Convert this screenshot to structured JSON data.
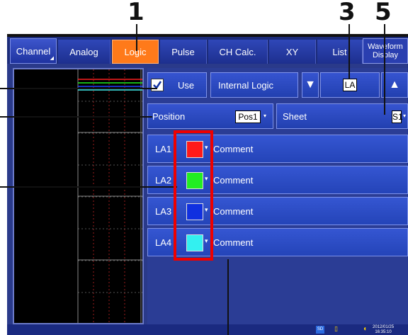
{
  "callouts": [
    "1",
    "3",
    "5"
  ],
  "tabs": [
    {
      "label": "Channel"
    },
    {
      "label": "Analog"
    },
    {
      "label": "Logic"
    },
    {
      "label": "Pulse"
    },
    {
      "label": "CH Calc."
    },
    {
      "label": "XY"
    },
    {
      "label": "List"
    },
    {
      "label": "Waveform Display"
    }
  ],
  "controls": {
    "use_label": "Use",
    "use_checked": true,
    "mode_label": "Internal Logic",
    "group_value": "LA",
    "position_label": "Position",
    "position_value": "Pos1",
    "sheet_label": "Sheet",
    "sheet_value": "S1"
  },
  "channels": [
    {
      "label": "LA1",
      "color": "#ff1a1a",
      "comment": "Comment"
    },
    {
      "label": "LA2",
      "color": "#22ee22",
      "comment": "Comment"
    },
    {
      "label": "LA3",
      "color": "#1030e0",
      "comment": "Comment"
    },
    {
      "label": "LA4",
      "color": "#33f0f0",
      "comment": "Comment"
    }
  ],
  "status": {
    "sd_label": "SD",
    "date": "2012/01/25",
    "time": "16:35:10"
  },
  "colors": {
    "active_tab": "#ff7a1a",
    "highlight": "#e00000"
  }
}
